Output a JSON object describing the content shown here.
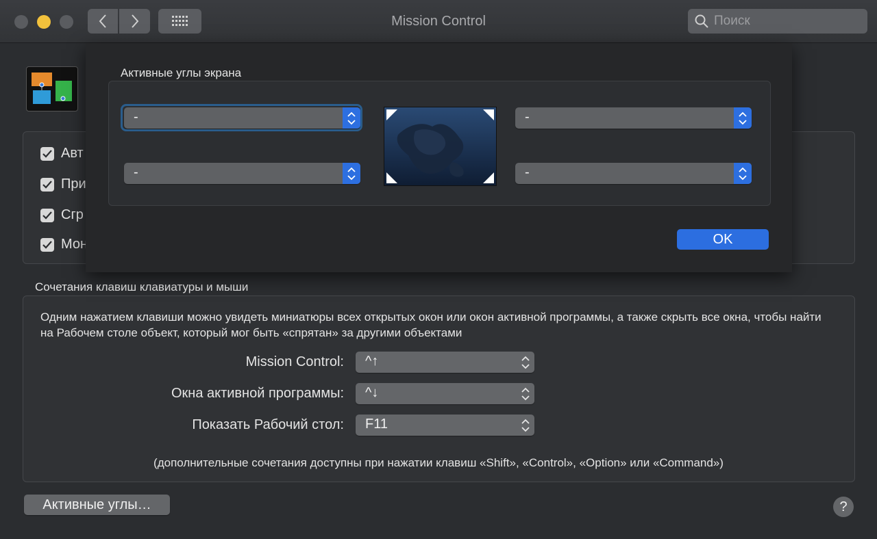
{
  "window": {
    "title": "Mission Control",
    "search_placeholder": "Поиск"
  },
  "checkboxes": [
    {
      "label": "Авт",
      "checked": true
    },
    {
      "label": "При",
      "checked": true
    },
    {
      "label": "Сгр",
      "checked": true
    },
    {
      "label": "Мон",
      "checked": true
    }
  ],
  "keyboard": {
    "section_title": "Сочетания клавиш клавиатуры и мыши",
    "description": "Одним нажатием клавиши можно увидеть миниатюры всех открытых окон или окон активной программы, а также скрыть все окна, чтобы найти на Рабочем столе объект, который мог быть «спрятан» за другими объектами",
    "rows": [
      {
        "label": "Mission Control:",
        "value": "^↑"
      },
      {
        "label": "Окна активной программы:",
        "value": "^↓"
      },
      {
        "label": "Показать Рабочий стол:",
        "value": "F11"
      }
    ],
    "hint": "(дополнительные сочетания доступны при нажатии клавиш «Shift», «Control», «Option» или «Command»)"
  },
  "footer": {
    "hot_corners_button": "Активные углы…",
    "help": "?"
  },
  "sheet": {
    "title": "Активные углы экрана",
    "corners": {
      "top_left": "-",
      "top_right": "-",
      "bottom_left": "-",
      "bottom_right": "-"
    },
    "ok_label": "OK"
  },
  "colors": {
    "accent": "#2c6ee0",
    "minimize": "#f2c13c"
  }
}
